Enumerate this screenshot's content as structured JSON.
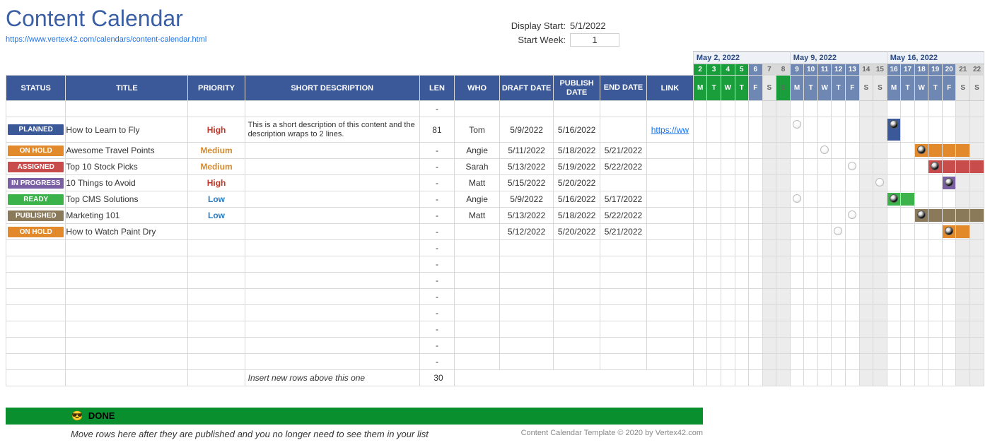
{
  "page": {
    "title": "Content Calendar",
    "source_url_text": "https://www.vertex42.com/calendars/content-calendar.html"
  },
  "controls": {
    "display_start_label": "Display Start:",
    "display_start_value": "5/1/2022",
    "start_week_label": "Start Week:",
    "start_week_value": "1"
  },
  "headers": {
    "status": "STATUS",
    "title": "TITLE",
    "priority": "PRIORITY",
    "desc": "SHORT DESCRIPTION",
    "len": "LEN",
    "who": "WHO",
    "draft": "DRAFT DATE",
    "publish": "PUBLISH DATE",
    "end": "END DATE",
    "link": "LINK"
  },
  "weeks": [
    {
      "label": "May 2, 2022",
      "days": [
        2,
        3,
        4,
        5,
        6,
        7,
        8
      ],
      "today": [
        2,
        3,
        4,
        5,
        8
      ]
    },
    {
      "label": "May 9, 2022",
      "days": [
        9,
        10,
        11,
        12,
        13,
        14,
        15
      ],
      "today": []
    },
    {
      "label": "May 16, 2022",
      "days": [
        16,
        17,
        18,
        19,
        20,
        21,
        22
      ],
      "today": []
    }
  ],
  "dow": [
    "M",
    "T",
    "W",
    "T",
    "F",
    "S",
    "S"
  ],
  "status_colors": {
    "PLANNED": "#3b5998",
    "ON HOLD": "#e28a2b",
    "ASSIGNED": "#c94c4c",
    "IN PROGRESS": "#7a5fa5",
    "READY": "#3bb24a",
    "PUBLISHED": "#8a7a5a"
  },
  "priority_colors": {
    "High": "#c0392b",
    "Medium": "#d68a2d",
    "Low": "#2a7bc0"
  },
  "rows": [
    {
      "status": "",
      "title": "",
      "priority": "",
      "desc": "",
      "len": "-",
      "who": "",
      "draft": "",
      "publish": "",
      "end": "",
      "link": "",
      "gantt": []
    },
    {
      "status": "PLANNED",
      "title": "How to Learn to Fly",
      "priority": "High",
      "desc": "This is a short description of this content and the description wraps to 2 lines.",
      "len": "81",
      "who": "Tom",
      "draft": "5/9/2022",
      "publish": "5/16/2022",
      "end": "",
      "link": "https://ww",
      "gantt": [
        {
          "type": "dotlight",
          "day": 9
        },
        {
          "type": "bar",
          "day": 16,
          "color": "#3b5998",
          "dot": true
        }
      ]
    },
    {
      "status": "ON HOLD",
      "title": "Awesome Travel Points",
      "priority": "Medium",
      "desc": "",
      "len": "-",
      "who": "Angie",
      "draft": "5/11/2022",
      "publish": "5/18/2022",
      "end": "5/21/2022",
      "link": "",
      "gantt": [
        {
          "type": "dotlight",
          "day": 11
        },
        {
          "type": "bar",
          "day": 18,
          "to": 21,
          "color": "#e28a2b",
          "dot": true
        }
      ]
    },
    {
      "status": "ASSIGNED",
      "title": "Top 10 Stock Picks",
      "priority": "Medium",
      "desc": "",
      "len": "-",
      "who": "Sarah",
      "draft": "5/13/2022",
      "publish": "5/19/2022",
      "end": "5/22/2022",
      "link": "",
      "gantt": [
        {
          "type": "dotlight",
          "day": 13
        },
        {
          "type": "bar",
          "day": 19,
          "to": 22,
          "color": "#c94c4c",
          "dot": true
        }
      ]
    },
    {
      "status": "IN PROGRESS",
      "title": "10 Things to Avoid",
      "priority": "High",
      "desc": "",
      "len": "-",
      "who": "Matt",
      "draft": "5/15/2022",
      "publish": "5/20/2022",
      "end": "",
      "link": "",
      "gantt": [
        {
          "type": "dotlight",
          "day": 15
        },
        {
          "type": "bar",
          "day": 20,
          "color": "#7a5fa5",
          "dot": true
        }
      ]
    },
    {
      "status": "READY",
      "title": "Top CMS Solutions",
      "priority": "Low",
      "desc": "",
      "len": "-",
      "who": "Angie",
      "draft": "5/9/2022",
      "publish": "5/16/2022",
      "end": "5/17/2022",
      "link": "",
      "gantt": [
        {
          "type": "dotlight",
          "day": 9
        },
        {
          "type": "bar",
          "day": 16,
          "to": 17,
          "color": "#3bb24a",
          "dot": true
        }
      ]
    },
    {
      "status": "PUBLISHED",
      "title": "Marketing 101",
      "priority": "Low",
      "desc": "",
      "len": "-",
      "who": "Matt",
      "draft": "5/13/2022",
      "publish": "5/18/2022",
      "end": "5/22/2022",
      "link": "",
      "gantt": [
        {
          "type": "dotlight",
          "day": 13
        },
        {
          "type": "bar",
          "day": 18,
          "to": 22,
          "color": "#8a7a5a",
          "dot": true
        }
      ]
    },
    {
      "status": "ON HOLD",
      "title": "How to Watch Paint Dry",
      "priority": "",
      "desc": "",
      "len": "-",
      "who": "",
      "draft": "5/12/2022",
      "publish": "5/20/2022",
      "end": "5/21/2022",
      "link": "",
      "gantt": [
        {
          "type": "dotlight",
          "day": 12
        },
        {
          "type": "bar",
          "day": 20,
          "to": 21,
          "color": "#e28a2b",
          "dot": true
        }
      ]
    },
    {
      "status": "",
      "title": "",
      "priority": "",
      "desc": "",
      "len": "-",
      "who": "",
      "draft": "",
      "publish": "",
      "end": "",
      "link": "",
      "gantt": []
    },
    {
      "status": "",
      "title": "",
      "priority": "",
      "desc": "",
      "len": "-",
      "who": "",
      "draft": "",
      "publish": "",
      "end": "",
      "link": "",
      "gantt": []
    },
    {
      "status": "",
      "title": "",
      "priority": "",
      "desc": "",
      "len": "-",
      "who": "",
      "draft": "",
      "publish": "",
      "end": "",
      "link": "",
      "gantt": []
    },
    {
      "status": "",
      "title": "",
      "priority": "",
      "desc": "",
      "len": "-",
      "who": "",
      "draft": "",
      "publish": "",
      "end": "",
      "link": "",
      "gantt": []
    },
    {
      "status": "",
      "title": "",
      "priority": "",
      "desc": "",
      "len": "-",
      "who": "",
      "draft": "",
      "publish": "",
      "end": "",
      "link": "",
      "gantt": []
    },
    {
      "status": "",
      "title": "",
      "priority": "",
      "desc": "",
      "len": "-",
      "who": "",
      "draft": "",
      "publish": "",
      "end": "",
      "link": "",
      "gantt": []
    },
    {
      "status": "",
      "title": "",
      "priority": "",
      "desc": "",
      "len": "-",
      "who": "",
      "draft": "",
      "publish": "",
      "end": "",
      "link": "",
      "gantt": []
    },
    {
      "status": "",
      "title": "",
      "priority": "",
      "desc": "",
      "len": "-",
      "who": "",
      "draft": "",
      "publish": "",
      "end": "",
      "link": "",
      "gantt": []
    }
  ],
  "instruction_row": {
    "desc": "Insert new rows above this one",
    "len": "30"
  },
  "done": {
    "emoji": "😎",
    "label": "DONE",
    "note": "Move rows here after they are published and you no longer need to see them in your list",
    "copyright": "Content Calendar Template © 2020 by Vertex42.com"
  }
}
